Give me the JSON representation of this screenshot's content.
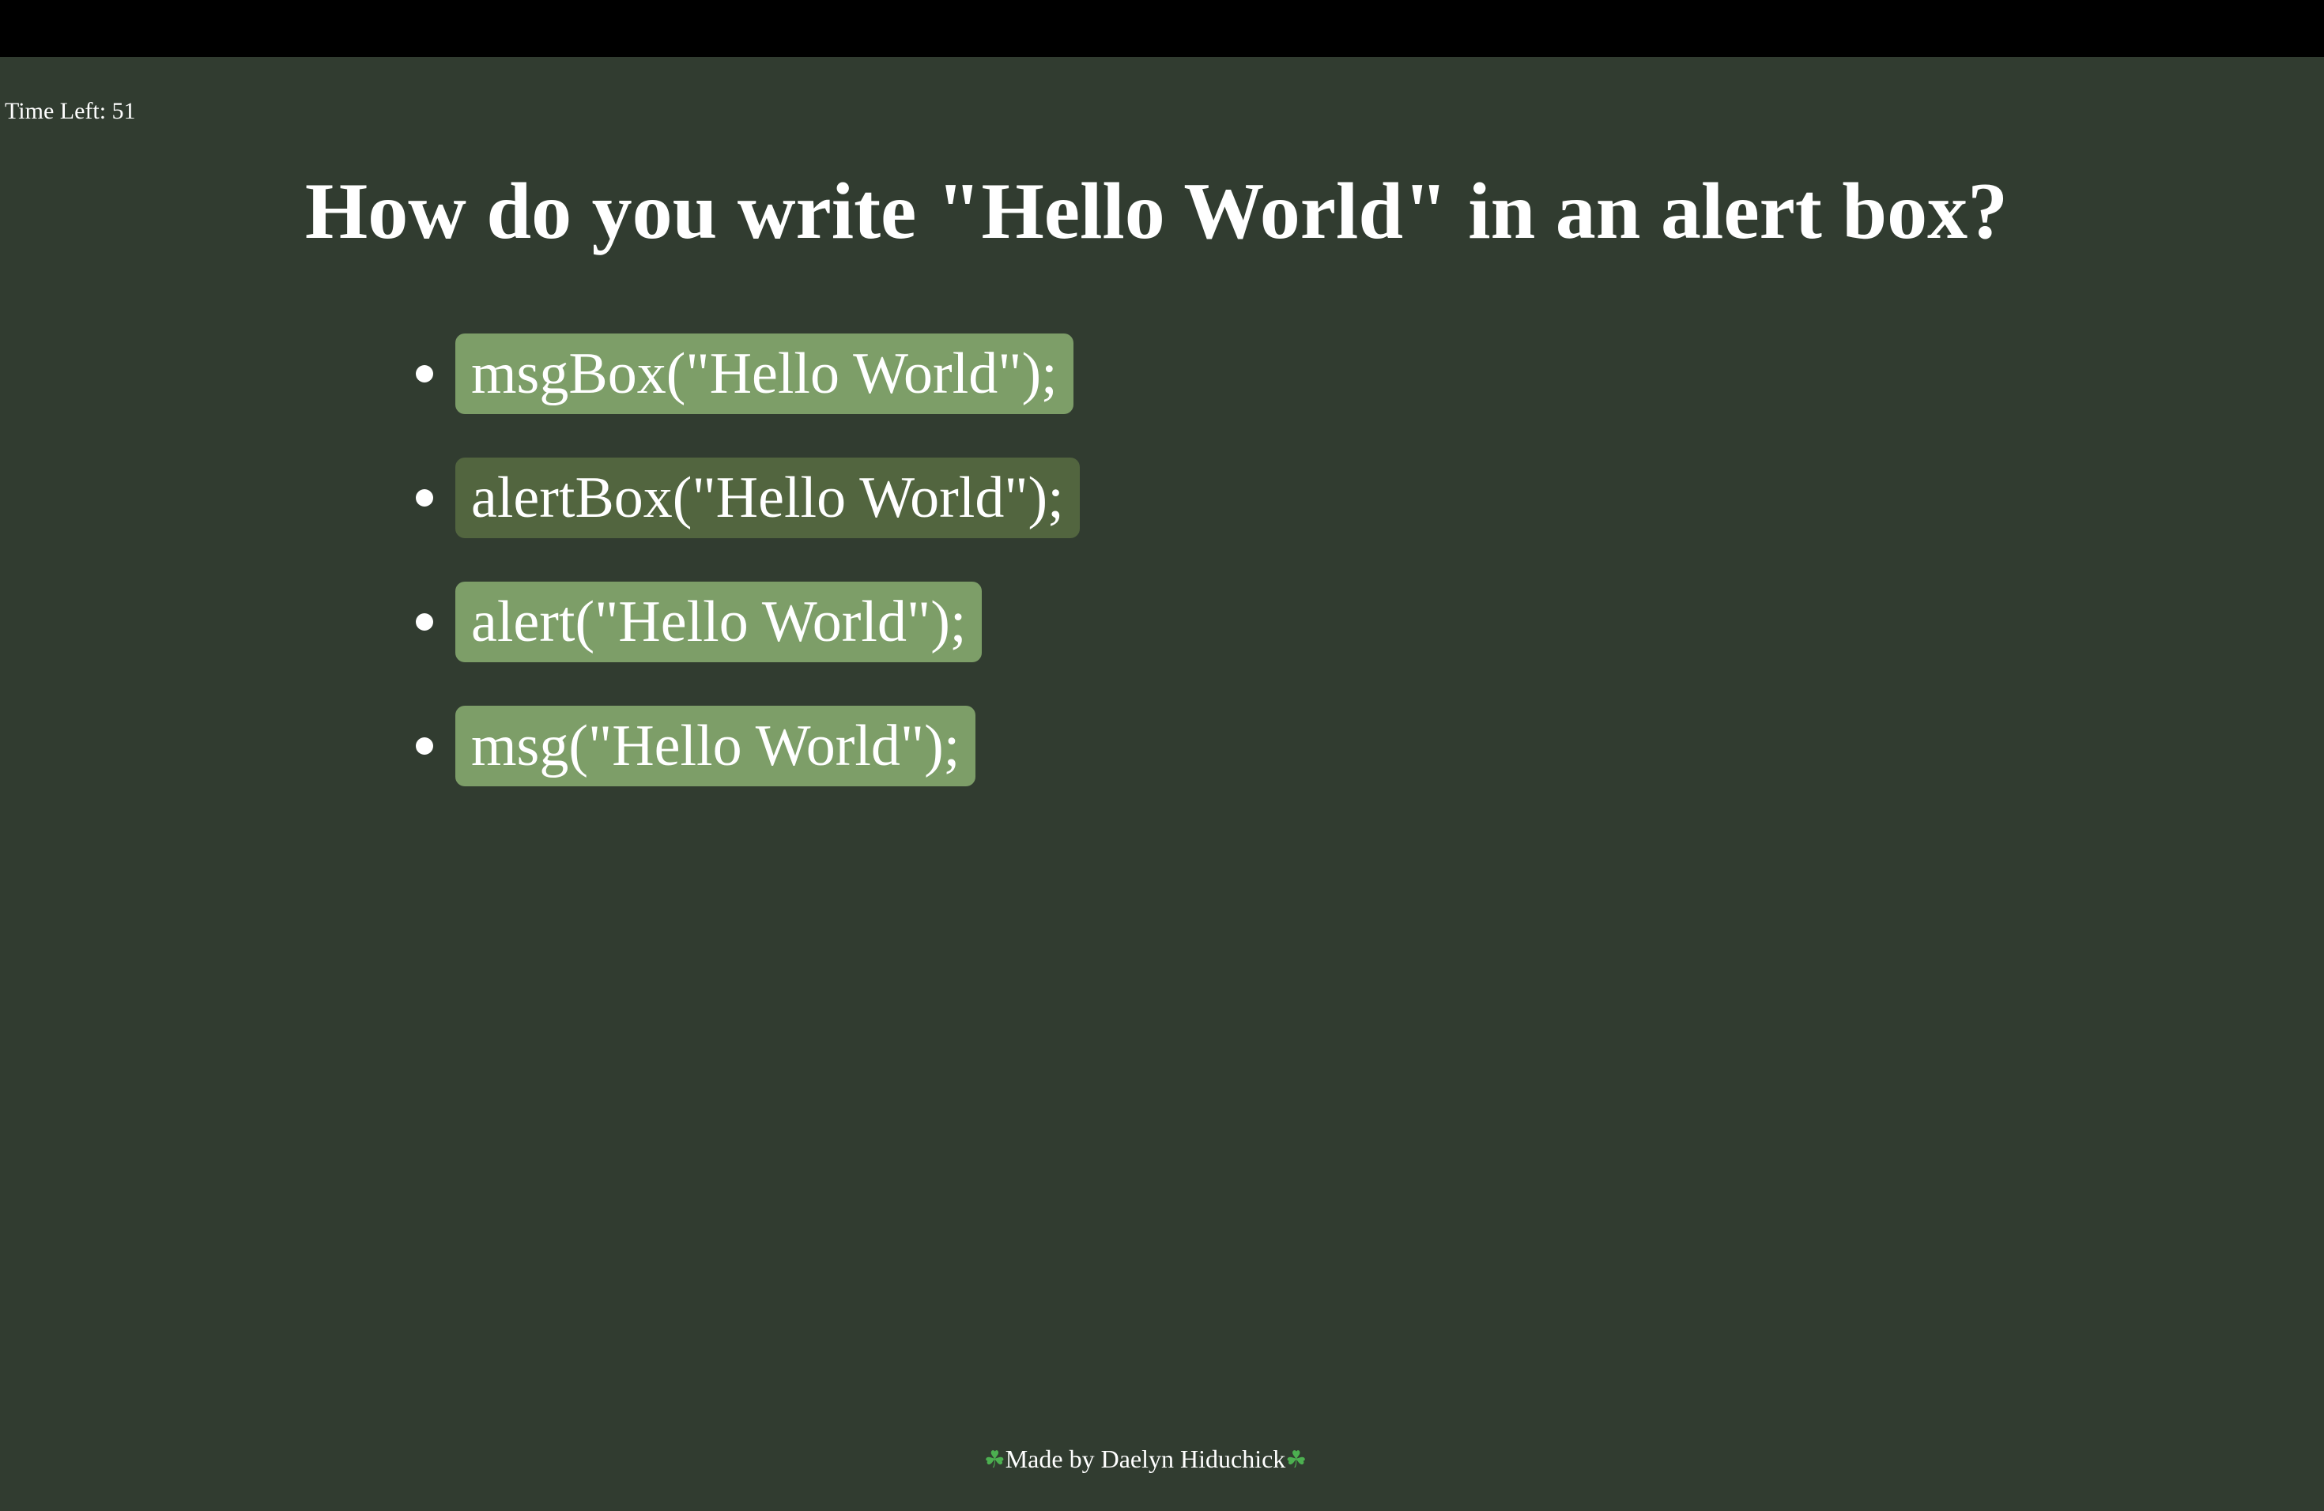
{
  "timer": {
    "label": "Time Left: 51"
  },
  "question": {
    "text": "How do you write \"Hello World\" in an alert box?"
  },
  "choices": [
    {
      "label": "msgBox(\"Hello World\");"
    },
    {
      "label": "alertBox(\"Hello World\");",
      "state": "hovered"
    },
    {
      "label": "alert(\"Hello World\");"
    },
    {
      "label": "msg(\"Hello World\");"
    }
  ],
  "footer": {
    "clover_left": "☘",
    "text": "Made by Daelyn Hiduchick",
    "clover_right": "☘"
  },
  "colors": {
    "background": "#313c30",
    "top_bar": "#000000",
    "choice_button": "#7d9e68",
    "choice_button_hover": "#52653f",
    "text": "#ffffff",
    "clover": "#4caf50"
  }
}
